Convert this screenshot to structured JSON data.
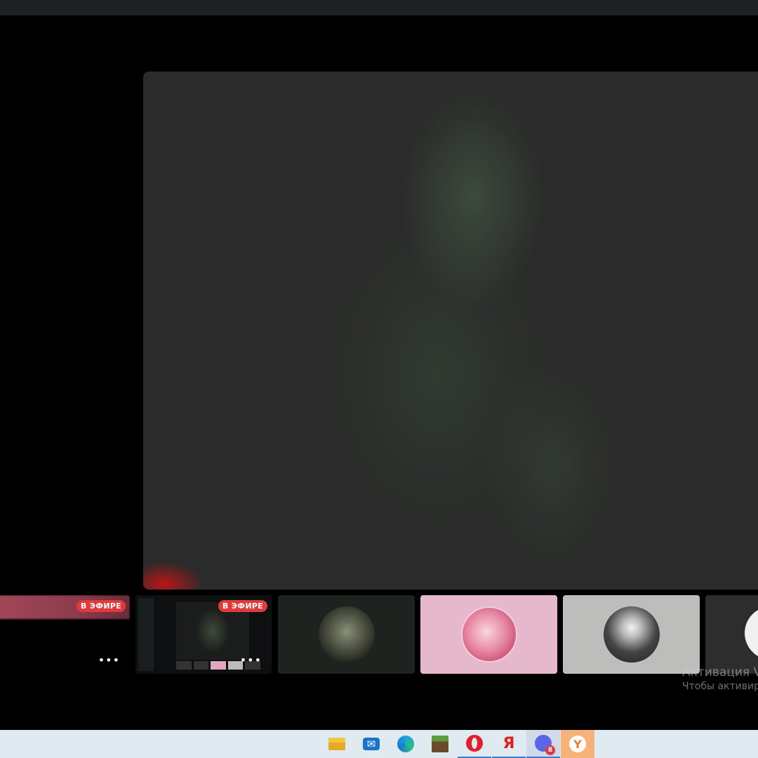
{
  "stream_tiles": [
    {
      "live_label": "В ЭФИРЕ"
    },
    {
      "live_label": "В ЭФИРЕ"
    }
  ],
  "icons": {
    "more": "more-options-icon",
    "live": "live-badge"
  },
  "participants": [
    {
      "avatar": "ryuk-avatar"
    },
    {
      "avatar": "anime-girl-avatar"
    },
    {
      "avatar": "white-hair-avatar"
    },
    {
      "avatar": "partial-avatar"
    }
  ],
  "watermark": {
    "title": "Активация V",
    "subtitle": "Чтобы активиров"
  },
  "taskbar": {
    "apps": [
      "file-explorer-icon",
      "mail-icon",
      "edge-icon",
      "minecraft-icon",
      "opera-icon",
      "yandex-icon",
      "discord-icon",
      "yandex-browser-icon"
    ],
    "discord_badge": "8"
  },
  "colors": {
    "live_red": "#e03b3b",
    "taskbar_bg": "#dfeaf1",
    "app_titlebar": "#1e2124"
  }
}
